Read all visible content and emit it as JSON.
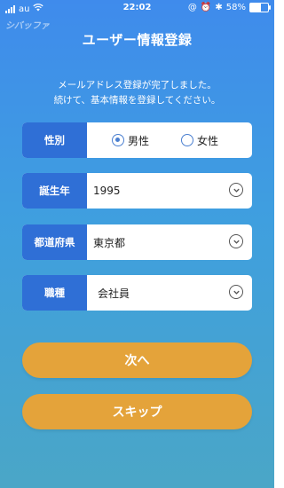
{
  "status_bar": {
    "carrier": "au",
    "time": "22:02",
    "battery": "58%",
    "battery_level": 0.58
  },
  "watermark": "シバッファ",
  "page": {
    "title": "ユーザー情報登録",
    "intro_line1": "メールアドレス登録が完了しました。",
    "intro_line2": "続けて、基本情報を登録してください。"
  },
  "form": {
    "gender": {
      "label": "性別",
      "options": [
        "男性",
        "女性"
      ],
      "selected": "男性"
    },
    "birth_year": {
      "label": "誕生年",
      "value": "1995"
    },
    "prefecture": {
      "label": "都道府県",
      "value": "東京都"
    },
    "occupation": {
      "label": "職種",
      "value": "会社員"
    }
  },
  "buttons": {
    "next": "次へ",
    "skip": "スキップ"
  },
  "colors": {
    "accent": "#2f6fd6",
    "button": "#e4a33a"
  }
}
